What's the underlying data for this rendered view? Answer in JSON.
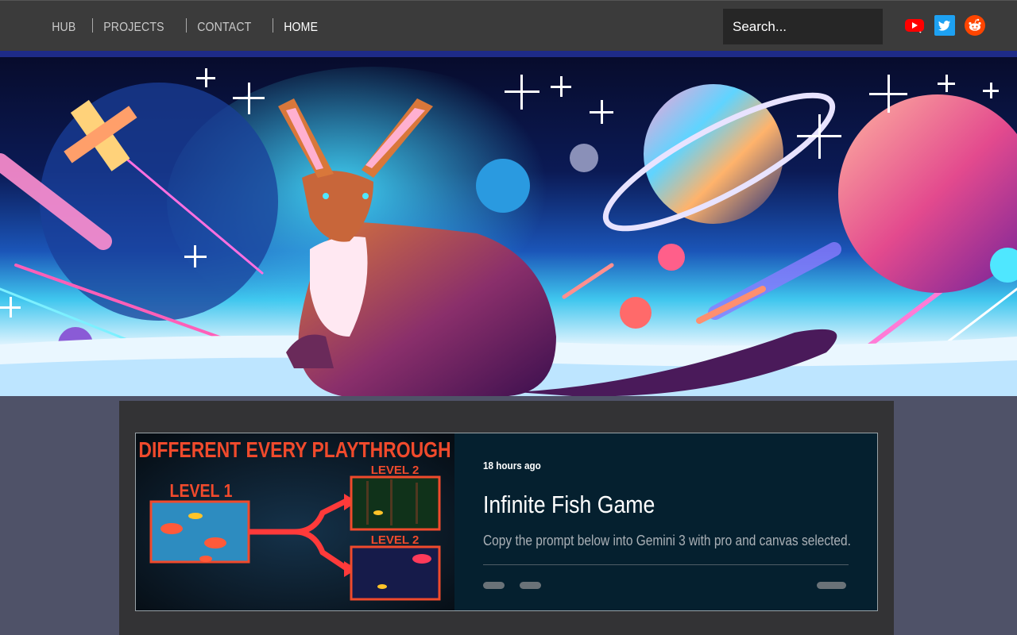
{
  "nav": {
    "items": [
      {
        "label": "HUB"
      },
      {
        "label": "PROJECTS"
      },
      {
        "label": "CONTACT"
      },
      {
        "label": "HOME",
        "active": true
      }
    ]
  },
  "search": {
    "placeholder": "Search...",
    "icon": "search-icon"
  },
  "socials": [
    {
      "name": "youtube-icon",
      "color": "#ff0000"
    },
    {
      "name": "twitter-icon",
      "color": "#1da1f2"
    },
    {
      "name": "reddit-icon",
      "color": "#ff4500"
    }
  ],
  "hero": {
    "image": "pixel-art kangaroo in space banner"
  },
  "post": {
    "time": "18 hours ago",
    "title": "Infinite Fish Game",
    "excerpt": "Copy the prompt below into Gemini 3 with pro and canvas selected.",
    "thumbnail": {
      "headline": "DIFFERENT EVERY PLAYTHROUGH",
      "level1": "LEVEL 1",
      "level2a": "LEVEL 2",
      "level2b": "LEVEL 2"
    }
  },
  "colors": {
    "topbar": "#3b3b3b",
    "page_bg": "#4f5268",
    "panel": "#333335",
    "card": "#05202f",
    "thumb_red": "#e8382a"
  }
}
